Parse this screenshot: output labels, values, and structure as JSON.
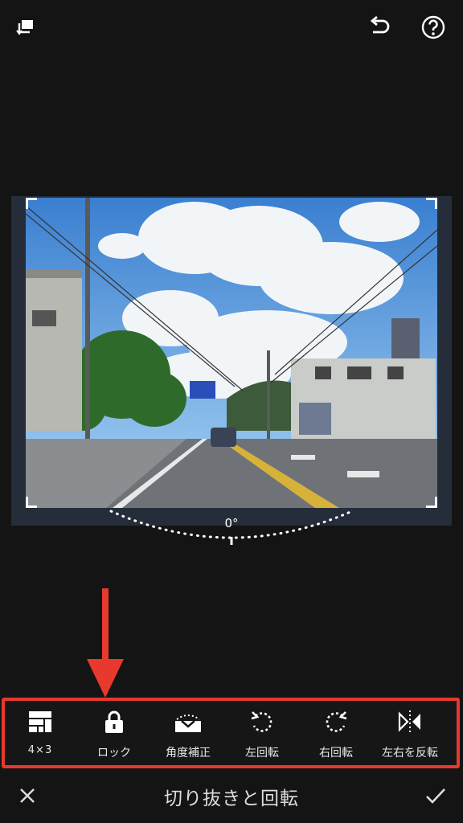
{
  "top_bar": {
    "compare_icon": "compare-icon",
    "undo_icon": "undo-icon",
    "help_icon": "help-icon"
  },
  "editor": {
    "angle_value": "0°"
  },
  "toolbar": {
    "items": [
      {
        "label": "4×3",
        "icon": "aspect-ratio-icon"
      },
      {
        "label": "ロック",
        "icon": "lock-icon"
      },
      {
        "label": "角度補正",
        "icon": "angle-correct-icon"
      },
      {
        "label": "左回転",
        "icon": "rotate-left-icon"
      },
      {
        "label": "右回転",
        "icon": "rotate-right-icon"
      },
      {
        "label": "左右を反転",
        "icon": "flip-horizontal-icon"
      }
    ]
  },
  "bottom_bar": {
    "title": "切り抜きと回転",
    "cancel_icon": "close-icon",
    "confirm_icon": "check-icon"
  },
  "colors": {
    "background": "#141414",
    "highlight": "#e8392e"
  }
}
